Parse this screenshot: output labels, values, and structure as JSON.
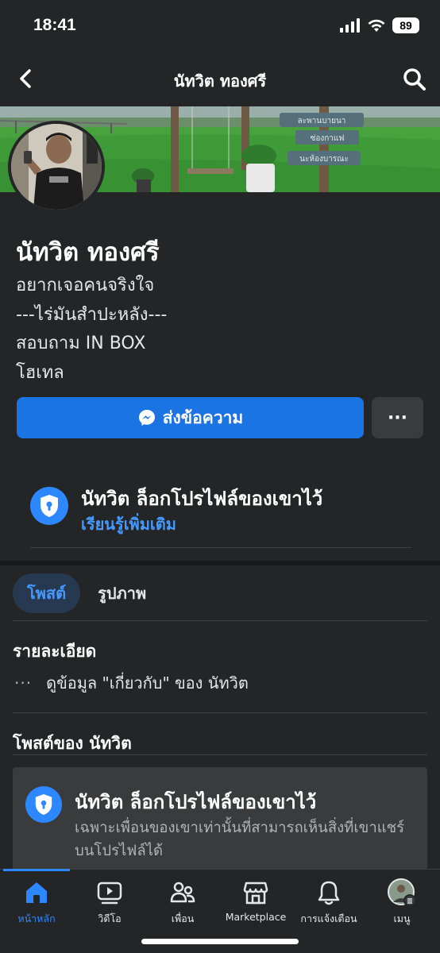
{
  "status_bar": {
    "time": "18:41",
    "battery": "89"
  },
  "header": {
    "title": "นัทวิต ทองศรี"
  },
  "cover": {
    "signs": [
      "ละพานบายนา",
      "ซ่องกาแฟ",
      "นะห้องบารณะ"
    ]
  },
  "profile": {
    "name": "นัทวิต ทองศรี",
    "bio": [
      "อยากเจอคนจริงใจ",
      "---ไร่มันสำปะหลัง---",
      "สอบถาม IN BOX",
      "โฮเทล"
    ]
  },
  "actions": {
    "message_label": "ส่งข้อความ",
    "more_label": "···"
  },
  "lock_notice": {
    "title": "นัทวิต ล็อกโปรไฟล์ของเขาไว้",
    "link": "เรียนรู้เพิ่มเติม"
  },
  "tabs": [
    {
      "label": "โพสต์",
      "active": true
    },
    {
      "label": "รูปภาพ",
      "active": false
    }
  ],
  "details": {
    "heading": "รายละเอียด",
    "about_dots": "···",
    "about_text": "ดูข้อมูล \"เกี่ยวกับ\" ของ นัทวิต"
  },
  "posts": {
    "heading": "โพสต์ของ นัทวิต",
    "locked_title": "นัทวิต ล็อกโปรไฟล์ของเขาไว้",
    "locked_desc": "เฉพาะเพื่อนของเขาเท่านั้นที่สามารถเห็นสิ่งที่เขาแชร์บนโปรไฟล์ได้"
  },
  "bottom_nav": [
    {
      "label": "หน้าหลัก",
      "icon": "home-icon",
      "active": true
    },
    {
      "label": "วิดีโอ",
      "icon": "video-icon",
      "active": false
    },
    {
      "label": "เพื่อน",
      "icon": "friends-icon",
      "active": false
    },
    {
      "label": "Marketplace",
      "icon": "marketplace-icon",
      "active": false
    },
    {
      "label": "การแจ้งเตือน",
      "icon": "bell-icon",
      "active": false
    },
    {
      "label": "เมนู",
      "icon": "menu-avatar-icon",
      "active": false
    }
  ],
  "colors": {
    "background": "#242526",
    "accent": "#1b74e4",
    "link": "#4599ff"
  }
}
